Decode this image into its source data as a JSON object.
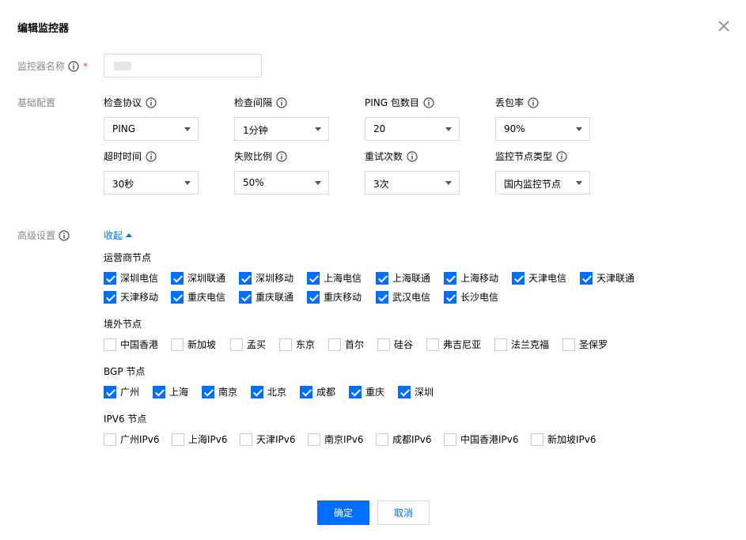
{
  "dialog": {
    "title": "编辑监控器"
  },
  "name_field": {
    "label": "监控器名称",
    "required_mark": "*"
  },
  "basic": {
    "label": "基础配置",
    "fields": [
      {
        "label": "检查协议",
        "value": "PING"
      },
      {
        "label": "检查间隔",
        "value": "1分钟"
      },
      {
        "label": "PING 包数目",
        "value": "20"
      },
      {
        "label": "丢包率",
        "value": "90%"
      },
      {
        "label": "超时时间",
        "value": "30秒"
      },
      {
        "label": "失败比例",
        "value": "50%"
      },
      {
        "label": "重试次数",
        "value": "3次"
      },
      {
        "label": "监控节点类型",
        "value": "国内监控节点"
      }
    ]
  },
  "advanced": {
    "label": "高级设置",
    "toggle_label": "收起",
    "groups": [
      {
        "title": "运营商节点",
        "items": [
          {
            "label": "深圳电信",
            "checked": true
          },
          {
            "label": "深圳联通",
            "checked": true
          },
          {
            "label": "深圳移动",
            "checked": true
          },
          {
            "label": "上海电信",
            "checked": true
          },
          {
            "label": "上海联通",
            "checked": true
          },
          {
            "label": "上海移动",
            "checked": true
          },
          {
            "label": "天津电信",
            "checked": true
          },
          {
            "label": "天津联通",
            "checked": true
          },
          {
            "label": "天津移动",
            "checked": true
          },
          {
            "label": "重庆电信",
            "checked": true
          },
          {
            "label": "重庆联通",
            "checked": true
          },
          {
            "label": "重庆移动",
            "checked": true
          },
          {
            "label": "武汉电信",
            "checked": true
          },
          {
            "label": "长沙电信",
            "checked": true
          }
        ]
      },
      {
        "title": "境外节点",
        "items": [
          {
            "label": "中国香港",
            "checked": false
          },
          {
            "label": "新加坡",
            "checked": false
          },
          {
            "label": "孟买",
            "checked": false
          },
          {
            "label": "东京",
            "checked": false
          },
          {
            "label": "首尔",
            "checked": false
          },
          {
            "label": "硅谷",
            "checked": false
          },
          {
            "label": "弗吉尼亚",
            "checked": false
          },
          {
            "label": "法兰克福",
            "checked": false
          },
          {
            "label": "圣保罗",
            "checked": false
          }
        ]
      },
      {
        "title": "BGP 节点",
        "items": [
          {
            "label": "广州",
            "checked": true
          },
          {
            "label": "上海",
            "checked": true
          },
          {
            "label": "南京",
            "checked": true
          },
          {
            "label": "北京",
            "checked": true
          },
          {
            "label": "成都",
            "checked": true
          },
          {
            "label": "重庆",
            "checked": true
          },
          {
            "label": "深圳",
            "checked": true
          }
        ]
      },
      {
        "title": "IPV6 节点",
        "items": [
          {
            "label": "广州IPv6",
            "checked": false
          },
          {
            "label": "上海IPv6",
            "checked": false
          },
          {
            "label": "天津IPv6",
            "checked": false
          },
          {
            "label": "南京IPv6",
            "checked": false
          },
          {
            "label": "成都IPv6",
            "checked": false
          },
          {
            "label": "中国香港IPv6",
            "checked": false
          },
          {
            "label": "新加坡IPv6",
            "checked": false
          }
        ]
      }
    ]
  },
  "footer": {
    "confirm": "确定",
    "cancel": "取消"
  },
  "colors": {
    "primary": "#006eff",
    "required": "#e54545"
  }
}
